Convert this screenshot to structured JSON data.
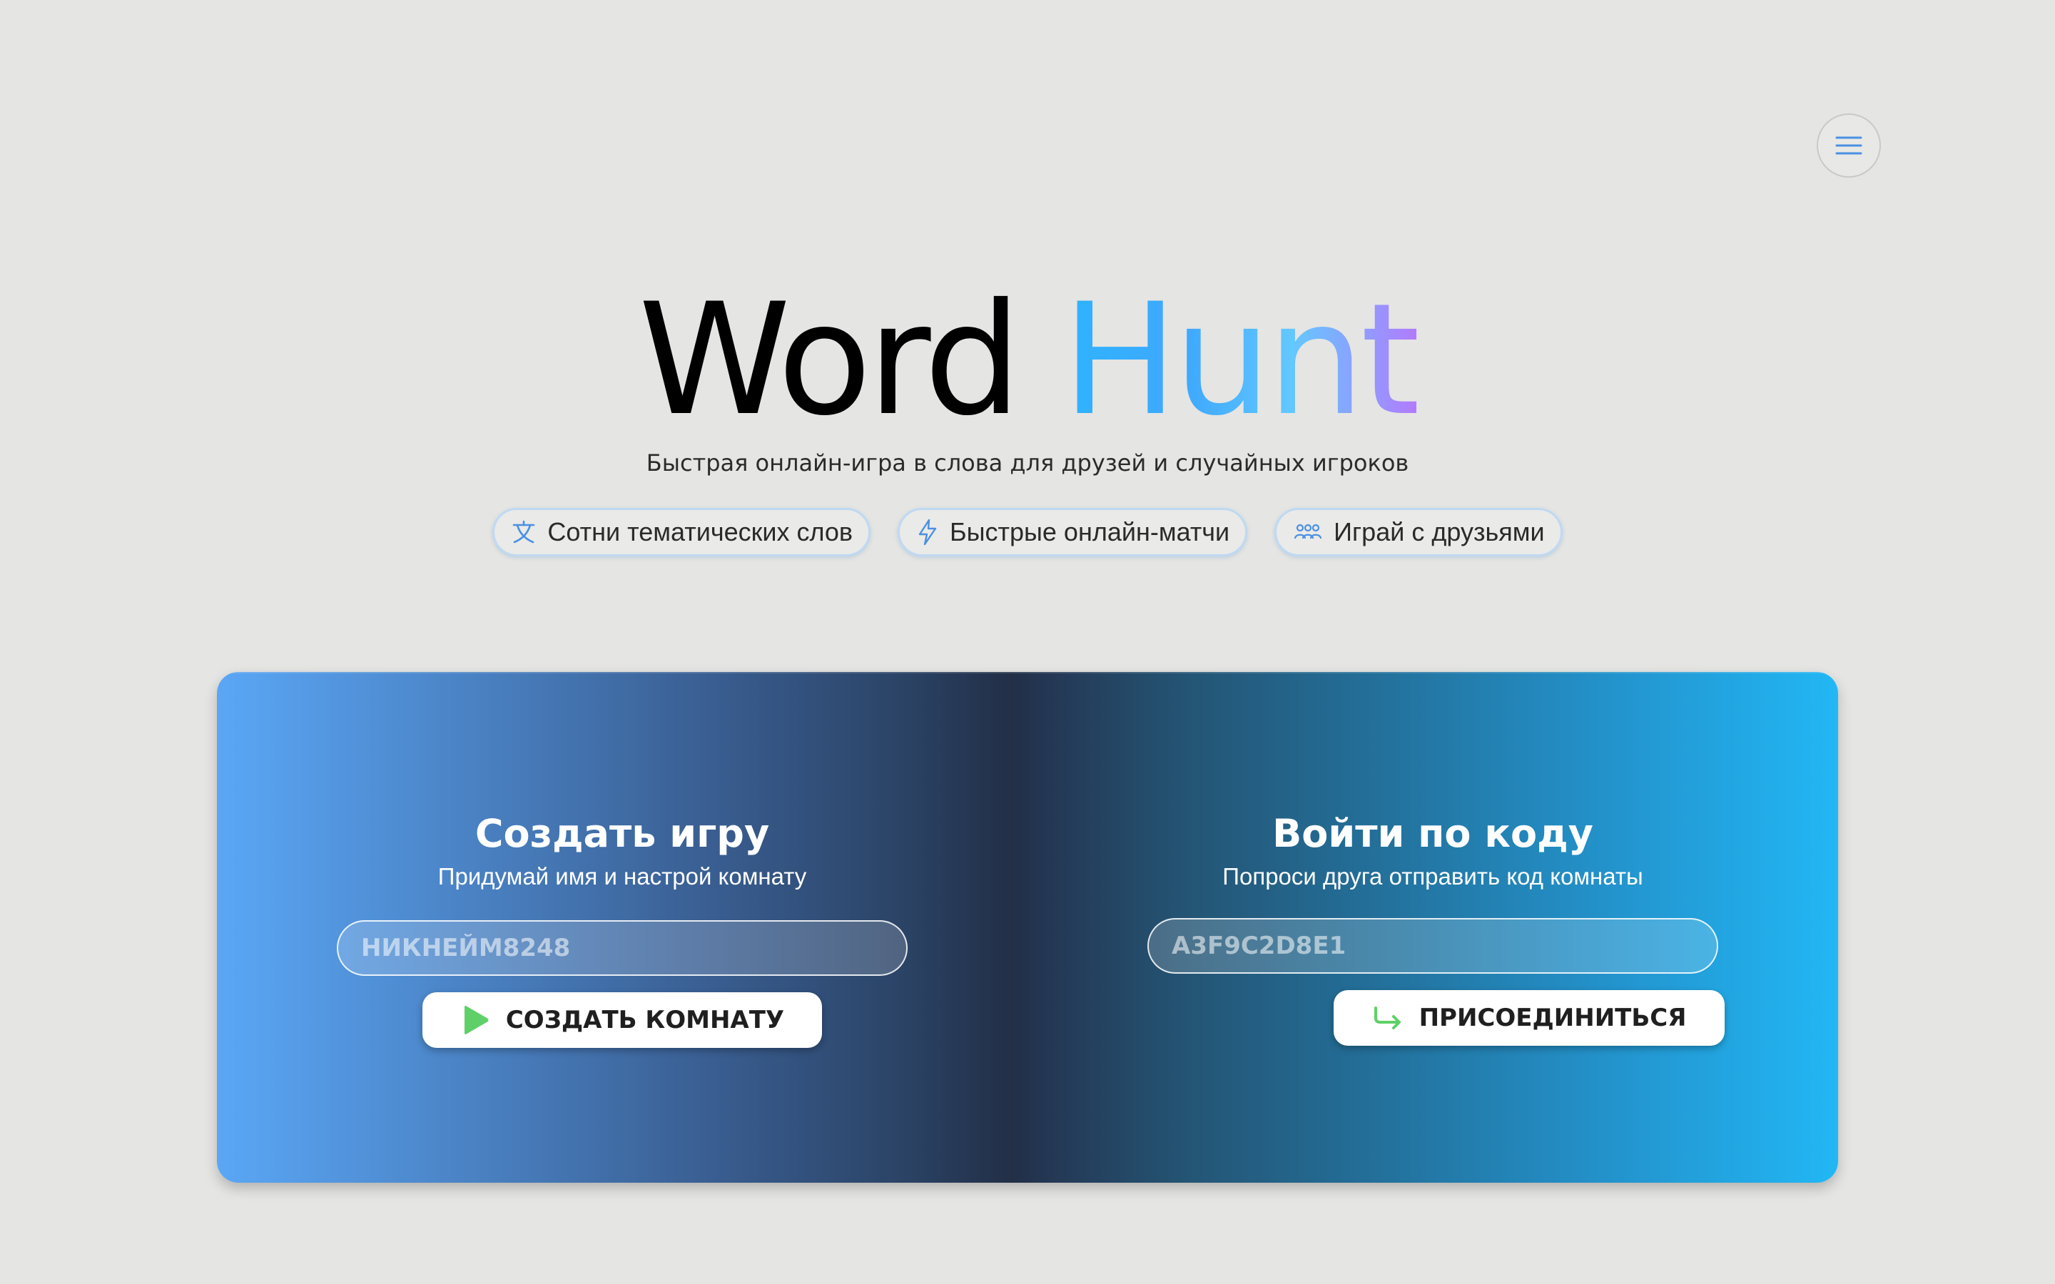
{
  "header": {
    "menu_icon": "hamburger-menu-icon"
  },
  "hero": {
    "title_part1": "Word",
    "title_part2": "Hunt",
    "subtitle": "Быстрая онлайн-игра в слова для друзей и случайных игроков",
    "features": [
      {
        "icon": "translate-icon",
        "label": "Сотни тематических слов"
      },
      {
        "icon": "lightning-icon",
        "label": "Быстрые онлайн-матчи"
      },
      {
        "icon": "users-icon",
        "label": "Играй с друзьями"
      }
    ]
  },
  "create": {
    "heading": "Создать игру",
    "description": "Придумай имя и настрой комнату",
    "nickname_placeholder": "НИКНЕЙМ8248",
    "button_label": "СОЗДАТЬ КОМНАТУ",
    "button_icon": "play-icon"
  },
  "join": {
    "heading": "Войти по коду",
    "description": "Попроси друга отправить код комнаты",
    "code_placeholder": "A3F9C2D8E1",
    "button_label": "ПРИСОЕДИНИТЬСЯ",
    "button_icon": "enter-arrow-icon"
  },
  "colors": {
    "background": "#e5e5e3",
    "accent_blue": "#3ea8ff",
    "accent_purple": "#b27bff",
    "chip_border": "#bfd9f2",
    "play_green": "#5fd068"
  }
}
